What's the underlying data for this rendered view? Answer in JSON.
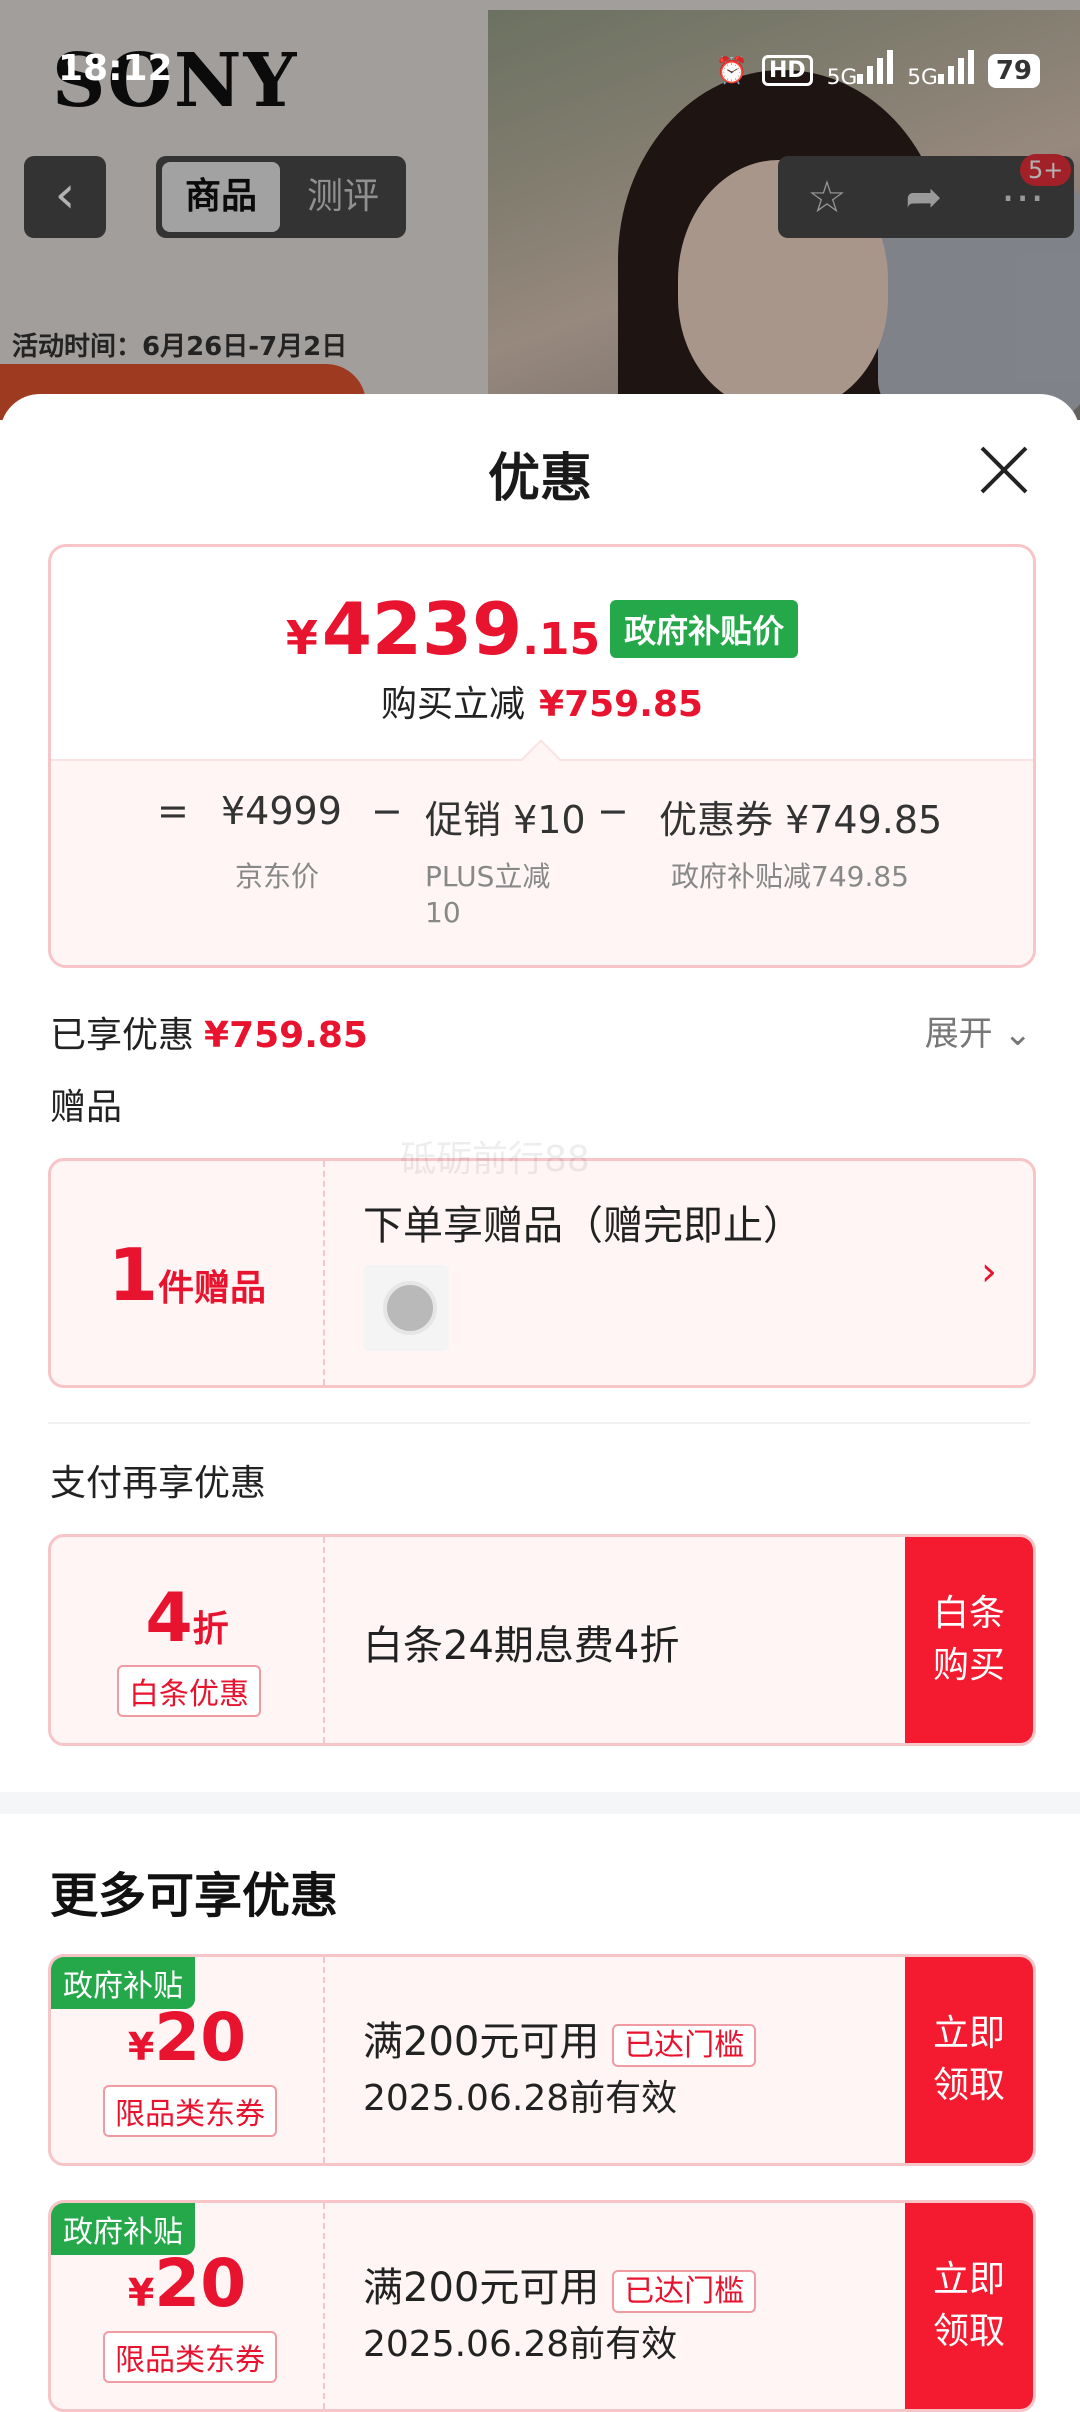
{
  "background": {
    "status": {
      "time": "18:12",
      "hd": "HD",
      "net1": "5G",
      "net2": "5G",
      "battery": "79"
    },
    "logo": "SONY",
    "tabs": [
      "商品",
      "测评"
    ],
    "badge": "5+",
    "activity_time": "活动时间：6月26日-7月2日"
  },
  "sheet": {
    "title": "优惠",
    "price": {
      "yen": "¥",
      "integer": "4239",
      "decimal": ".15",
      "tag": "政府补贴价",
      "reduce_label": "购买立减",
      "reduce_amount": "¥759.85"
    },
    "breakdown": {
      "eq": "=",
      "jd_price": "¥4999",
      "jd_label": "京东价",
      "minus1": "−",
      "promo": "促销 ¥10",
      "promo_label1": "PLUS立减",
      "promo_label2": "10",
      "minus2": "−",
      "coupon": "优惠券 ¥749.85",
      "coupon_label": "政府补贴减749.85"
    },
    "enjoyed_label": "已享优惠",
    "enjoyed_amount": "¥759.85",
    "expand_label": "展开",
    "gift_section": "赠品",
    "gift": {
      "count": "1",
      "unit": "件赠品",
      "title": "下单享赠品（赠完即止）"
    },
    "pay_section": "支付再享优惠",
    "baitiao": {
      "num": "4",
      "unit": "折",
      "tag": "白条优惠",
      "text": "白条24期息费4折",
      "button_line1": "白条",
      "button_line2": "购买"
    },
    "more_title": "更多可享优惠",
    "coupons": [
      {
        "corner": "政府补贴",
        "yen": "¥",
        "amount": "20",
        "type": "限品类东券",
        "condition": "满200元可用",
        "status": "已达门槛",
        "valid": "2025.06.28前有效",
        "button_line1": "立即",
        "button_line2": "领取"
      },
      {
        "corner": "政府补贴",
        "yen": "¥",
        "amount": "20",
        "type": "限品类东券",
        "condition": "满200元可用",
        "status": "已达门槛",
        "valid": "2025.06.28前有效",
        "button_line1": "立即",
        "button_line2": "领取"
      }
    ],
    "watermark": "砥砺前行88"
  }
}
